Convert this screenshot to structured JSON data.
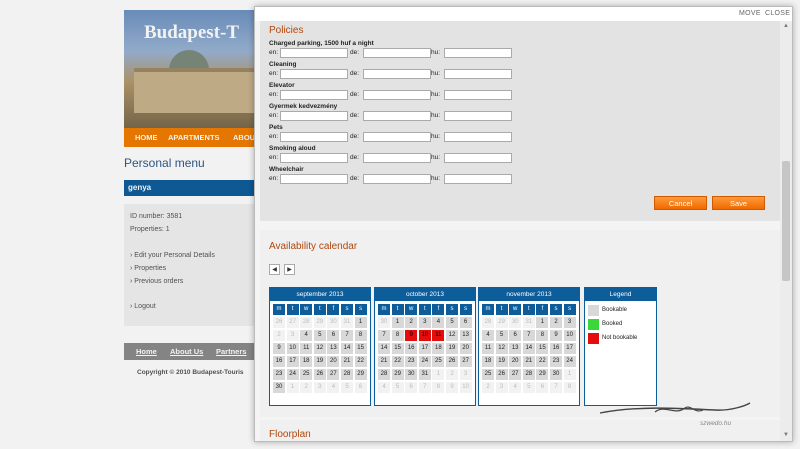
{
  "bg_site": {
    "banner_title": "Budapest-T",
    "topnav": [
      "HOME",
      "APARTMENTS",
      "ABOU"
    ],
    "personal_menu_title": "Personal menu",
    "username": "genya",
    "id_number": "ID number: 3581",
    "properties_count": "Properties: 1",
    "menu": [
      "Edit your Personal Details",
      "Properties",
      "Previous orders"
    ],
    "logout": "Logout",
    "footnav": [
      "Home",
      "About Us",
      "Partners"
    ],
    "copyright": "Copyright © 2010 Budapest-Touris"
  },
  "modal": {
    "move": "MOVE",
    "close": "CLOSE",
    "policies_title": "Policies",
    "lang_labels": [
      "en:",
      "de:",
      "hu:"
    ],
    "policies": [
      {
        "label": "Charged parking, 1500 huf a night"
      },
      {
        "label": "Cleaning"
      },
      {
        "label": "Elevator"
      },
      {
        "label": "Gyermek kedvezmény"
      },
      {
        "label": "Pets"
      },
      {
        "label": "Smoking aloud"
      },
      {
        "label": "Wheelchair"
      }
    ],
    "cancel_label": "Cancel",
    "save_label": "Save",
    "availability_title": "Availability calendar",
    "prev_icon": "◀",
    "next_icon": "▶",
    "weekdays": [
      "m",
      "t",
      "w",
      "t",
      "f",
      "s",
      "s"
    ],
    "calendars": [
      {
        "month": "september 2013",
        "days": [
          [
            "26",
            "muted"
          ],
          [
            "27",
            "muted"
          ],
          [
            "28",
            "muted"
          ],
          [
            "29",
            "muted"
          ],
          [
            "30",
            "muted"
          ],
          [
            "31",
            "muted"
          ],
          [
            "1",
            "avail"
          ],
          [
            "2",
            "muted"
          ],
          [
            "3",
            "muted"
          ],
          [
            "4",
            "avail"
          ],
          [
            "5",
            "avail"
          ],
          [
            "6",
            "avail"
          ],
          [
            "7",
            "avail"
          ],
          [
            "8",
            "avail"
          ],
          [
            "9",
            "avail"
          ],
          [
            "10",
            "avail"
          ],
          [
            "11",
            "avail"
          ],
          [
            "12",
            "avail"
          ],
          [
            "13",
            "avail"
          ],
          [
            "14",
            "avail"
          ],
          [
            "15",
            "avail"
          ],
          [
            "16",
            "avail"
          ],
          [
            "17",
            "avail"
          ],
          [
            "18",
            "avail"
          ],
          [
            "19",
            "avail"
          ],
          [
            "20",
            "avail"
          ],
          [
            "21",
            "avail"
          ],
          [
            "22",
            "avail"
          ],
          [
            "23",
            "avail"
          ],
          [
            "24",
            "avail"
          ],
          [
            "25",
            "avail"
          ],
          [
            "26",
            "avail"
          ],
          [
            "27",
            "avail"
          ],
          [
            "28",
            "avail"
          ],
          [
            "29",
            "avail"
          ],
          [
            "30",
            "avail"
          ],
          [
            "1",
            "muted"
          ],
          [
            "2",
            "muted"
          ],
          [
            "3",
            "muted"
          ],
          [
            "4",
            "muted"
          ],
          [
            "5",
            "muted"
          ],
          [
            "6",
            "muted"
          ]
        ]
      },
      {
        "month": "october 2013",
        "days": [
          [
            "30",
            "muted"
          ],
          [
            "1",
            "avail"
          ],
          [
            "2",
            "avail"
          ],
          [
            "3",
            "avail"
          ],
          [
            "4",
            "avail"
          ],
          [
            "5",
            "avail"
          ],
          [
            "6",
            "avail"
          ],
          [
            "7",
            "avail"
          ],
          [
            "8",
            "avail"
          ],
          [
            "9",
            "notbook"
          ],
          [
            "10",
            "notbook"
          ],
          [
            "11",
            "notbook"
          ],
          [
            "12",
            "avail"
          ],
          [
            "13",
            "avail"
          ],
          [
            "14",
            "avail"
          ],
          [
            "15",
            "avail"
          ],
          [
            "16",
            "avail"
          ],
          [
            "17",
            "avail"
          ],
          [
            "18",
            "avail"
          ],
          [
            "19",
            "avail"
          ],
          [
            "20",
            "avail"
          ],
          [
            "21",
            "avail"
          ],
          [
            "22",
            "avail"
          ],
          [
            "23",
            "avail"
          ],
          [
            "24",
            "avail"
          ],
          [
            "25",
            "avail"
          ],
          [
            "26",
            "avail"
          ],
          [
            "27",
            "avail"
          ],
          [
            "28",
            "avail"
          ],
          [
            "29",
            "avail"
          ],
          [
            "30",
            "avail"
          ],
          [
            "31",
            "avail"
          ],
          [
            "1",
            "muted"
          ],
          [
            "2",
            "muted"
          ],
          [
            "3",
            "muted"
          ],
          [
            "4",
            "muted"
          ],
          [
            "5",
            "muted"
          ],
          [
            "6",
            "muted"
          ],
          [
            "7",
            "muted"
          ],
          [
            "8",
            "muted"
          ],
          [
            "9",
            "muted"
          ],
          [
            "10",
            "muted"
          ]
        ]
      },
      {
        "month": "november 2013",
        "days": [
          [
            "28",
            "muted"
          ],
          [
            "29",
            "muted"
          ],
          [
            "30",
            "muted"
          ],
          [
            "31",
            "muted"
          ],
          [
            "1",
            "avail"
          ],
          [
            "2",
            "avail"
          ],
          [
            "3",
            "avail"
          ],
          [
            "4",
            "avail"
          ],
          [
            "5",
            "avail"
          ],
          [
            "6",
            "avail"
          ],
          [
            "7",
            "avail"
          ],
          [
            "8",
            "avail"
          ],
          [
            "9",
            "avail"
          ],
          [
            "10",
            "avail"
          ],
          [
            "11",
            "avail"
          ],
          [
            "12",
            "avail"
          ],
          [
            "13",
            "avail"
          ],
          [
            "14",
            "avail"
          ],
          [
            "15",
            "avail"
          ],
          [
            "16",
            "avail"
          ],
          [
            "17",
            "avail"
          ],
          [
            "18",
            "avail"
          ],
          [
            "19",
            "avail"
          ],
          [
            "20",
            "avail"
          ],
          [
            "21",
            "avail"
          ],
          [
            "22",
            "avail"
          ],
          [
            "23",
            "avail"
          ],
          [
            "24",
            "avail"
          ],
          [
            "25",
            "avail"
          ],
          [
            "26",
            "avail"
          ],
          [
            "27",
            "avail"
          ],
          [
            "28",
            "avail"
          ],
          [
            "29",
            "avail"
          ],
          [
            "30",
            "avail"
          ],
          [
            "1",
            "muted"
          ],
          [
            "2",
            "muted"
          ],
          [
            "3",
            "muted"
          ],
          [
            "4",
            "muted"
          ],
          [
            "5",
            "muted"
          ],
          [
            "6",
            "muted"
          ],
          [
            "7",
            "muted"
          ],
          [
            "8",
            "muted"
          ]
        ]
      }
    ],
    "legend_title": "Legend",
    "legend": [
      {
        "label": "Bookable",
        "color": "#d8d8d8"
      },
      {
        "label": "Booked",
        "color": "#39d739"
      },
      {
        "label": "Not bookable",
        "color": "#e30d0d"
      }
    ],
    "floorplan_title": "Floorplan",
    "watermark": "szwedo.hu"
  },
  "colors": {
    "accent": "#f27d00",
    "brand": "#0e5d9b",
    "title": "#b3470b"
  }
}
